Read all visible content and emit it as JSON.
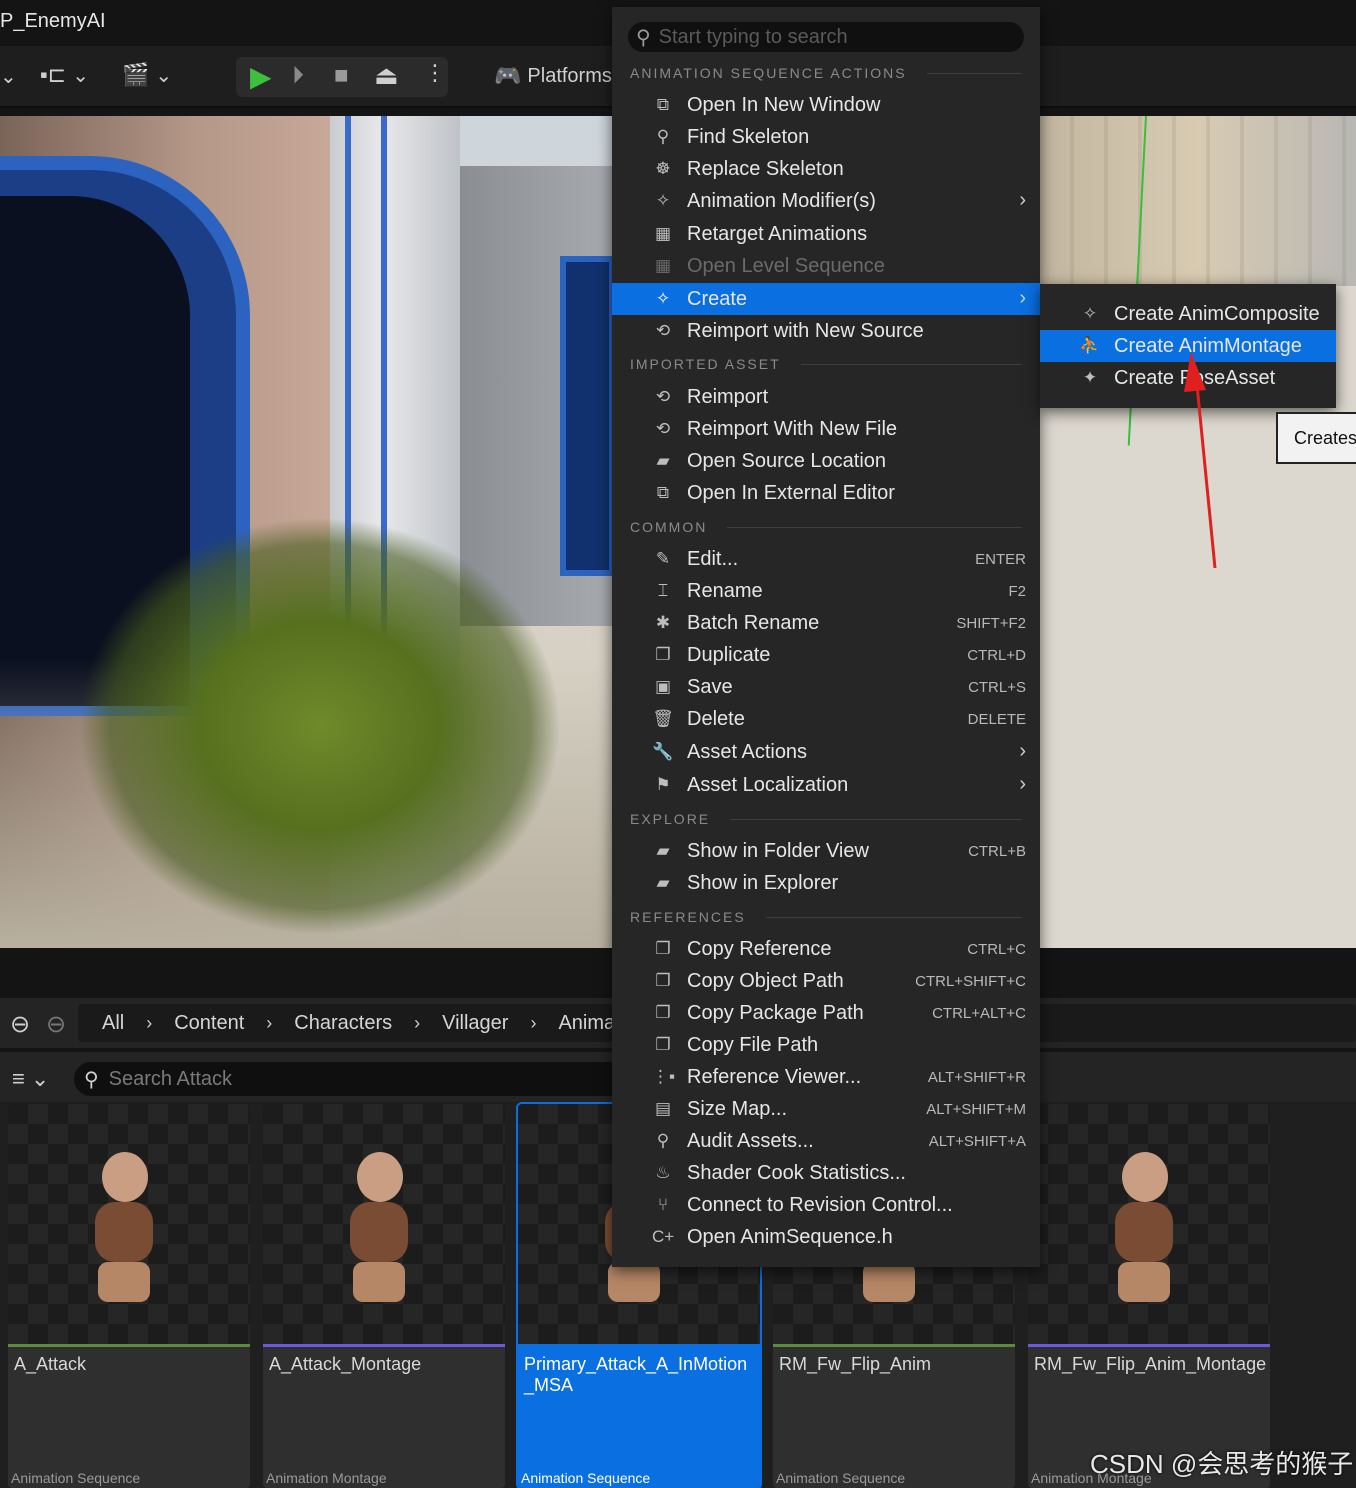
{
  "window": {
    "title": "P_EnemyAI"
  },
  "toolbar": {
    "platforms_label": "Platforms"
  },
  "menu": {
    "search_placeholder": "Start typing to search",
    "sections": {
      "anim_seq": "ANIMATION SEQUENCE ACTIONS",
      "imported": "IMPORTED ASSET",
      "common": "COMMON",
      "explore": "EXPLORE",
      "references": "REFERENCES"
    },
    "items": [
      {
        "label": "Open In New Window",
        "shortcut": "",
        "icon": "open-window-icon"
      },
      {
        "label": "Find Skeleton",
        "shortcut": "",
        "icon": "find-icon"
      },
      {
        "label": "Replace Skeleton",
        "shortcut": "",
        "icon": "skeleton-icon"
      },
      {
        "label": "Animation Modifier(s)",
        "shortcut": "",
        "icon": "modifier-icon"
      },
      {
        "label": "Retarget Animations",
        "shortcut": "",
        "icon": "retarget-icon"
      },
      {
        "label": "Open Level Sequence",
        "shortcut": "",
        "icon": "sequence-icon"
      },
      {
        "label": "Create",
        "shortcut": "",
        "icon": "create-icon"
      },
      {
        "label": "Reimport with New Source",
        "shortcut": "",
        "icon": "reimport-icon"
      },
      {
        "label": "Reimport",
        "shortcut": "",
        "icon": "reimport-icon"
      },
      {
        "label": "Reimport With New File",
        "shortcut": "",
        "icon": "reimport-icon"
      },
      {
        "label": "Open Source Location",
        "shortcut": "",
        "icon": "folder-icon"
      },
      {
        "label": "Open In External Editor",
        "shortcut": "",
        "icon": "external-icon"
      },
      {
        "label": "Edit...",
        "shortcut": "ENTER",
        "icon": "edit-icon"
      },
      {
        "label": "Rename",
        "shortcut": "F2",
        "icon": "rename-icon"
      },
      {
        "label": "Batch Rename",
        "shortcut": "SHIFT+F2",
        "icon": "batch-rename-icon"
      },
      {
        "label": "Duplicate",
        "shortcut": "CTRL+D",
        "icon": "duplicate-icon"
      },
      {
        "label": "Save",
        "shortcut": "CTRL+S",
        "icon": "save-icon"
      },
      {
        "label": "Delete",
        "shortcut": "DELETE",
        "icon": "delete-icon"
      },
      {
        "label": "Asset Actions",
        "shortcut": "",
        "icon": "wrench-icon"
      },
      {
        "label": "Asset Localization",
        "shortcut": "",
        "icon": "flag-icon"
      },
      {
        "label": "Show in Folder View",
        "shortcut": "CTRL+B",
        "icon": "folder-view-icon"
      },
      {
        "label": "Show in Explorer",
        "shortcut": "",
        "icon": "explorer-icon"
      },
      {
        "label": "Copy Reference",
        "shortcut": "CTRL+C",
        "icon": "copy-icon"
      },
      {
        "label": "Copy Object Path",
        "shortcut": "CTRL+SHIFT+C",
        "icon": "copy-icon"
      },
      {
        "label": "Copy Package Path",
        "shortcut": "CTRL+ALT+C",
        "icon": "copy-icon"
      },
      {
        "label": "Copy File Path",
        "shortcut": "",
        "icon": "copy-icon"
      },
      {
        "label": "Reference Viewer...",
        "shortcut": "ALT+SHIFT+R",
        "icon": "reference-viewer-icon"
      },
      {
        "label": "Size Map...",
        "shortcut": "ALT+SHIFT+M",
        "icon": "size-map-icon"
      },
      {
        "label": "Audit Assets...",
        "shortcut": "ALT+SHIFT+A",
        "icon": "audit-icon"
      },
      {
        "label": "Shader Cook Statistics...",
        "shortcut": "",
        "icon": "shader-icon"
      },
      {
        "label": "Connect to Revision Control...",
        "shortcut": "",
        "icon": "revision-control-icon"
      },
      {
        "label": "Open AnimSequence.h",
        "shortcut": "",
        "icon": "code-icon"
      }
    ]
  },
  "submenu": {
    "items": [
      {
        "label": "Create AnimComposite",
        "icon": "anim-composite-icon"
      },
      {
        "label": "Create AnimMontage",
        "icon": "anim-montage-icon"
      },
      {
        "label": "Create PoseAsset",
        "icon": "pose-asset-icon"
      }
    ],
    "tooltip": "Creates"
  },
  "content_browser": {
    "breadcrumbs": [
      "All",
      "Content",
      "Characters",
      "Villager",
      "Anima"
    ],
    "search_placeholder": "Search Attack",
    "assets": [
      {
        "name": "A_Attack",
        "type": "Animation Sequence",
        "bar_color": "#5c8a3c",
        "selected": false
      },
      {
        "name": "A_Attack_Montage",
        "type": "Animation Montage",
        "bar_color": "#6a5ae0",
        "selected": false
      },
      {
        "name": "Primary_Attack_A_InMotion_MSA",
        "type": "Animation Sequence",
        "bar_color": "#0a6fe0",
        "selected": true
      },
      {
        "name": "RM_Fw_Flip_Anim",
        "type": "Animation Sequence",
        "bar_color": "#5c8a3c",
        "selected": false
      },
      {
        "name": "RM_Fw_Flip_Anim_Montage",
        "type": "Animation Montage",
        "bar_color": "#6a5ae0",
        "selected": false
      }
    ]
  },
  "watermark": "CSDN @会思考的猴子"
}
